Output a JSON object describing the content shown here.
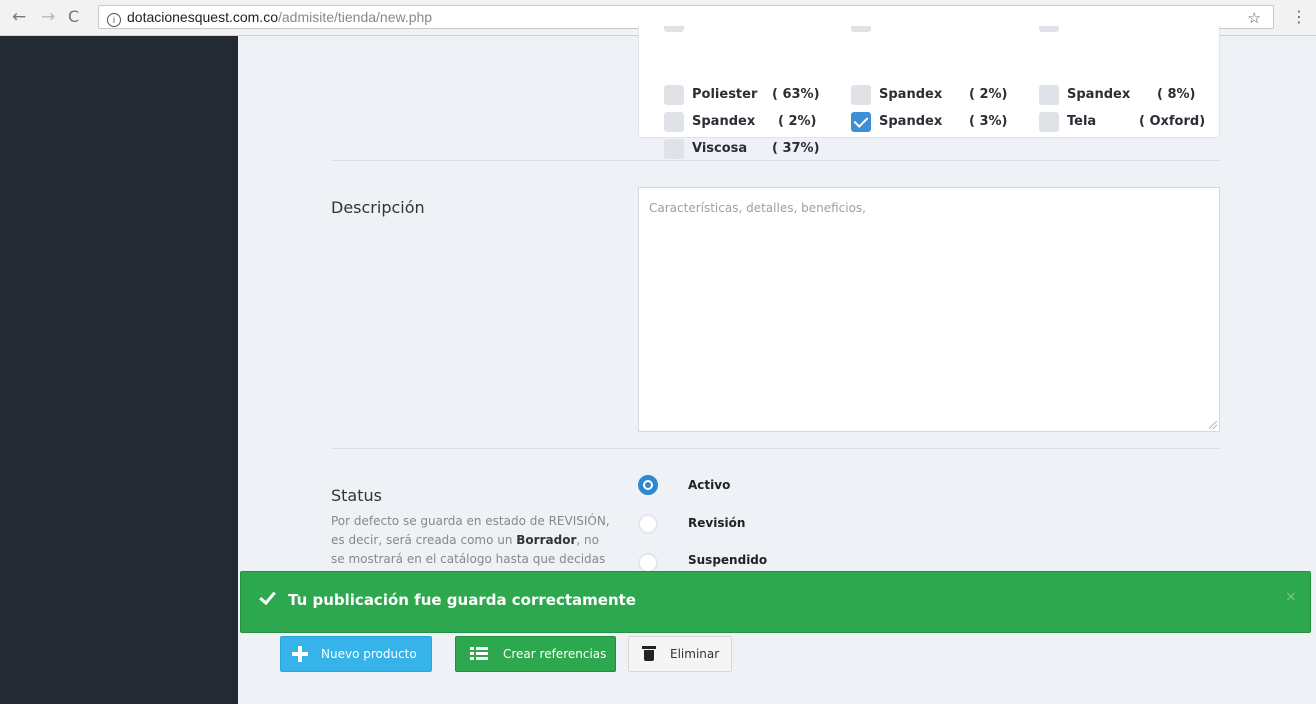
{
  "browser": {
    "url_domain": "dotacionesquest.com.co",
    "url_path": "/admisite/tienda/new.php"
  },
  "fabrics": {
    "items": [
      {
        "name": "Poliester",
        "pct": "( 63%)",
        "checked": false
      },
      {
        "name": "Spandex",
        "pct": "( 2%)",
        "checked": false
      },
      {
        "name": "Spandex",
        "pct": "( 8%)",
        "checked": false
      },
      {
        "name": "Spandex",
        "pct": "( 2%)",
        "checked": false
      },
      {
        "name": "Spandex",
        "pct": "( 3%)",
        "checked": true
      },
      {
        "name": "Tela",
        "pct": "( Oxford)",
        "checked": false
      },
      {
        "name": "Viscosa",
        "pct": "( 37%)",
        "checked": false
      }
    ]
  },
  "description": {
    "label": "Descripción",
    "placeholder": "Características, detalles, beneficios,"
  },
  "status": {
    "label": "Status",
    "help_prefix": "Por defecto se guarda en estado de REVISIÓN, es decir, será creada como un ",
    "help_bold": "Borrador",
    "help_suffix": ", no se mostrará en el catálogo hasta que decidas",
    "options": [
      {
        "label": "Activo",
        "selected": true
      },
      {
        "label": "Revisión",
        "selected": false
      },
      {
        "label": "Suspendido",
        "selected": false
      }
    ]
  },
  "toast": {
    "message": "Tu publicación fue guarda correctamente",
    "close": "×"
  },
  "actions": {
    "new_product": "Nuevo producto",
    "create_refs": "Crear referencias",
    "delete": "Eliminar"
  },
  "colors": {
    "sidebar": "#232a33",
    "toast": "#2ea84f",
    "primary": "#36b4ea",
    "accent": "#2f88d0"
  }
}
